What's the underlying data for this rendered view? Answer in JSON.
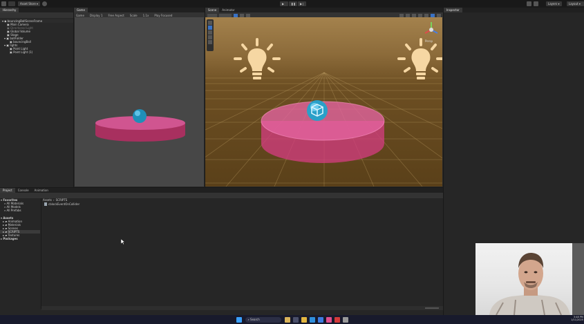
{
  "toolbar": {
    "asset_store": "Asset Store",
    "layers": "Layers",
    "layout": "Layout"
  },
  "hierarchy": {
    "tab_label": "Hierarchy",
    "items": [
      "bouncingBallSceneFrame",
      "Main Camera",
      "Directional Light",
      "Global Volume",
      "Stage",
      "ballFolder",
      "bouncingBall",
      "lights",
      "Point Light",
      "Point Light (1)"
    ]
  },
  "game": {
    "tab_label": "Game",
    "sub_items": [
      "Game",
      "Display 1",
      "Free Aspect",
      "Scale",
      "1.1x",
      "Play Focused"
    ]
  },
  "scene": {
    "tabs": [
      "Scene",
      "Animator"
    ],
    "persp_label": "Persp"
  },
  "inspector": {
    "tab_label": "Inspector"
  },
  "bottom": {
    "tabs": [
      "Project",
      "Console",
      "Animation"
    ],
    "favorites_header": "Favorites",
    "favorites": [
      "All Materials",
      "All Models",
      "All Prefabs"
    ],
    "assets_header": "Assets",
    "asset_folders": [
      "Animation",
      "Materials",
      "Scenes",
      "SCRIPTS",
      "Textures"
    ],
    "packages_header": "Packages",
    "breadcrumb": [
      "Assets",
      "SCRIPTS"
    ],
    "file_name": "cblockEventOnCollider"
  },
  "taskbar": {
    "search_label": "Search",
    "time": "3:48 PM",
    "date": "1/11/2025"
  },
  "colors": {
    "disc": "#c2407a",
    "ball": "#2aa0c8",
    "bulb": "#f6d7a3",
    "accent": "#3a72c4"
  }
}
